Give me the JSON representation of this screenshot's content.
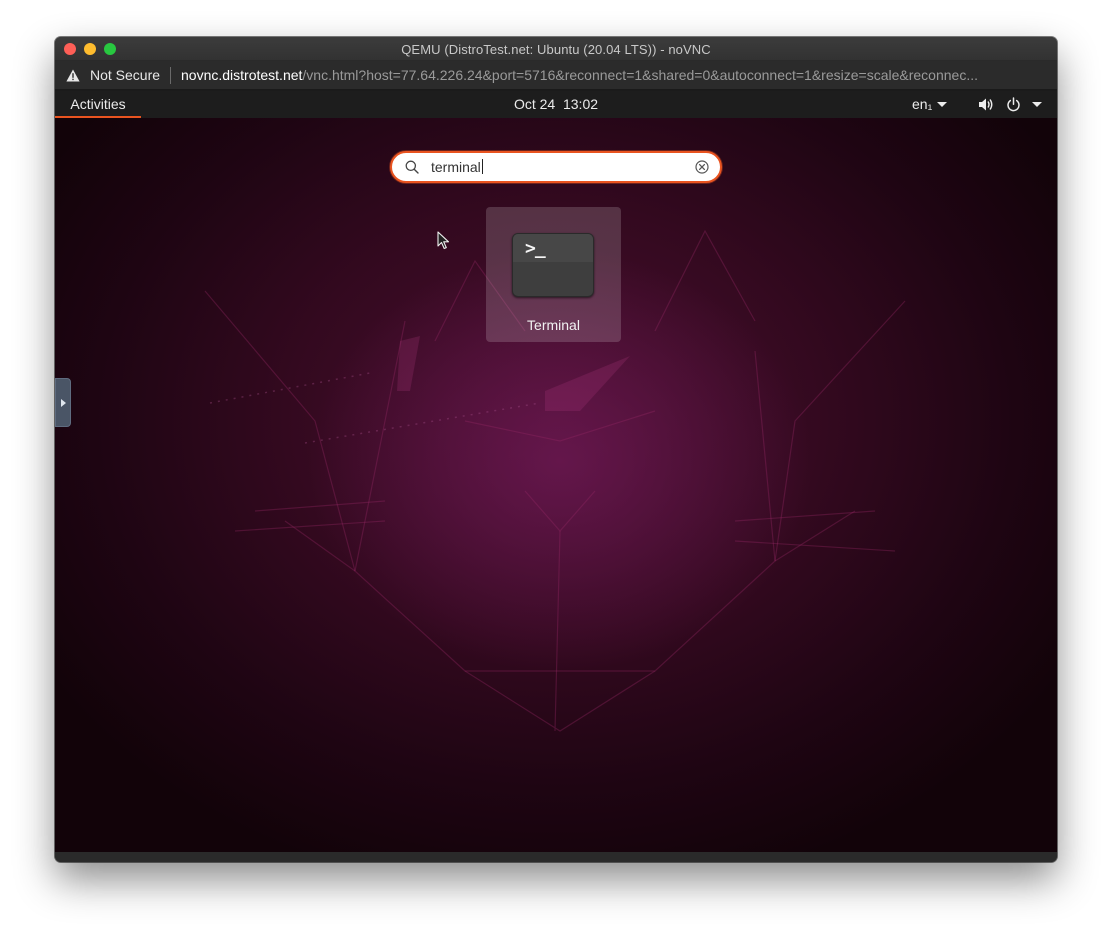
{
  "window": {
    "title": "QEMU (DistroTest.net: Ubuntu (20.04 LTS)) - noVNC"
  },
  "addressbar": {
    "security_label": "Not Secure",
    "url_host": "novnc.distrotest.net",
    "url_path": "/vnc.html?host=77.64.226.24&port=5716&reconnect=1&shared=0&autoconnect=1&resize=scale&reconnec..."
  },
  "panel": {
    "activities_label": "Activities",
    "date": "Oct 24",
    "time": "13:02",
    "language": "en₁"
  },
  "search": {
    "query": "terminal",
    "icon": "search-icon",
    "clear_icon": "clear-icon"
  },
  "results": [
    {
      "label": "Terminal",
      "icon": "terminal-icon",
      "icon_glyph": ">_"
    }
  ],
  "colors": {
    "accent": "#e95420",
    "panel_bg": "#1d1d1d",
    "wallpaper_dark": "#1f0513",
    "wallpaper_mid": "#4a0f30"
  }
}
